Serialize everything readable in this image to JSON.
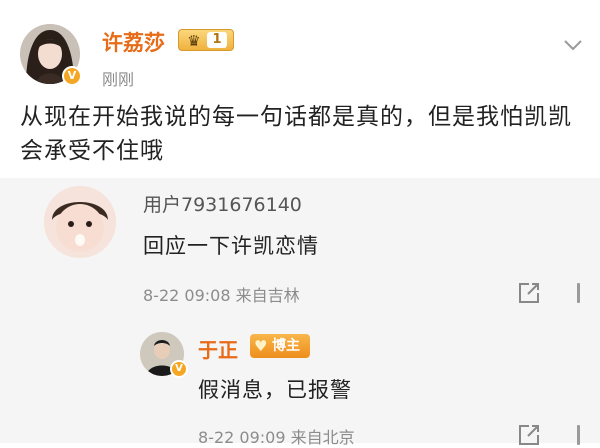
{
  "post": {
    "author": "许荔莎",
    "level": "1",
    "time": "刚刚",
    "body": "从现在开始我说的每一句话都是真的，但是我怕凯凯会承受不住哦"
  },
  "comment": {
    "user": "用户7931676140",
    "text": "回应一下许凯恋情",
    "meta": "8-22 09:08  来自吉林"
  },
  "reply": {
    "user": "于正",
    "badge": "博主",
    "text": "假消息，已报警",
    "meta": "8-22 09:09  来自北京"
  },
  "icons": {
    "verified": "verified-v-icon",
    "crown": "crown-icon",
    "heart": "heart-icon",
    "chevron": "chevron-down-icon",
    "share": "share-icon"
  },
  "colors": {
    "author_name": "#e86b18",
    "badge_gold": "#efb23e",
    "comment_bg": "#f5f5f5",
    "meta_text": "#8c8c8c"
  }
}
